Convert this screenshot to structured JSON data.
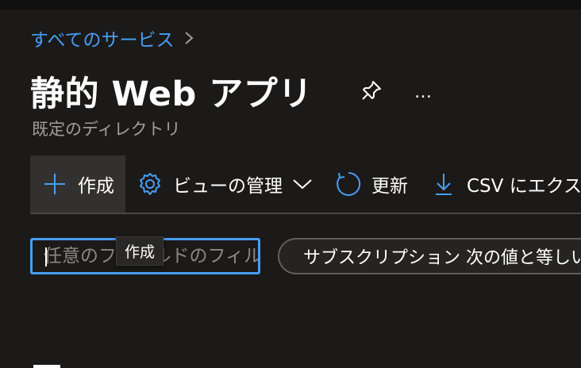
{
  "breadcrumb": {
    "link": "すべてのサービス",
    "chevron_icon": "chevron-right-icon"
  },
  "header": {
    "title": "静的 Web アプリ",
    "subtitle": "既定のディレクトリ",
    "pin_icon": "pin-icon",
    "more_label": "…"
  },
  "toolbar": {
    "create_label": "作成",
    "manage_view_label": "ビューの管理",
    "refresh_label": "更新",
    "csv_label": "CSV にエクスポート"
  },
  "filter": {
    "placeholder": "任意のフィールドのフィルター...",
    "subscription_pill": "サブスクリプション 次の値と等しい: すべて"
  },
  "tooltip": {
    "text": "作成"
  },
  "colors": {
    "accent": "#479ef5",
    "background": "#1b1a19",
    "toolbar_active": "#323130",
    "subtitle": "#a19f9d"
  }
}
